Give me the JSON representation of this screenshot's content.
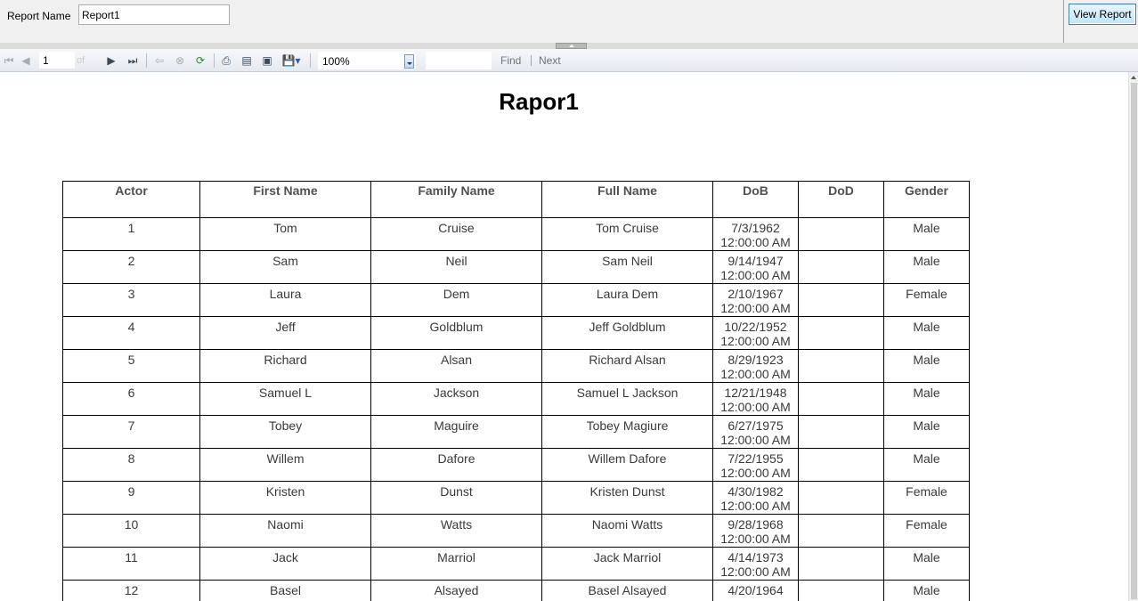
{
  "parameters": {
    "label": "Report Name",
    "value": "Report1"
  },
  "view_report_label": "View Report",
  "toolbar": {
    "page_number": "1",
    "zoom": "100%",
    "find_label": "Find",
    "next_label": "Next",
    "icons": [
      "first-page-icon",
      "previous-page-icon",
      "next-page-icon",
      "last-page-icon",
      "back-icon",
      "stop-icon",
      "refresh-icon",
      "print-icon",
      "print-layout-icon",
      "page-setup-icon",
      "export-icon"
    ]
  },
  "report": {
    "title": "Rapor1",
    "columns": [
      "Actor",
      "First Name",
      "Family Name",
      "Full Name",
      "DoB",
      "DoD",
      "Gender"
    ],
    "rows": [
      [
        "1",
        "Tom",
        "Cruise",
        "Tom Cruise",
        "7/3/1962",
        "12:00:00 AM",
        "",
        "Male"
      ],
      [
        "2",
        "Sam",
        "Neil",
        "Sam Neil",
        "9/14/1947",
        "12:00:00 AM",
        "",
        "Male"
      ],
      [
        "3",
        "Laura",
        "Dem",
        "Laura Dem",
        "2/10/1967",
        "12:00:00 AM",
        "",
        "Female"
      ],
      [
        "4",
        "Jeff",
        "Goldblum",
        "Jeff Goldblum",
        "10/22/1952",
        "12:00:00 AM",
        "",
        "Male"
      ],
      [
        "5",
        "Richard",
        "Alsan",
        "Richard Alsan",
        "8/29/1923",
        "12:00:00 AM",
        "",
        "Male"
      ],
      [
        "6",
        "Samuel L",
        "Jackson",
        "Samuel L Jackson",
        "12/21/1948",
        "12:00:00 AM",
        "",
        "Male"
      ],
      [
        "7",
        "Tobey",
        "Maguire",
        "Tobey Magiure",
        "6/27/1975",
        "12:00:00 AM",
        "",
        "Male"
      ],
      [
        "8",
        "Willem",
        "Dafore",
        "Willem Dafore",
        "7/22/1955",
        "12:00:00 AM",
        "",
        "Male"
      ],
      [
        "9",
        "Kristen",
        "Dunst",
        "Kristen Dunst",
        "4/30/1982",
        "12:00:00 AM",
        "",
        "Female"
      ],
      [
        "10",
        "Naomi",
        "Watts",
        "Naomi Watts",
        "9/28/1968",
        "12:00:00 AM",
        "",
        "Female"
      ],
      [
        "11",
        "Jack",
        "Marriol",
        "Jack Marriol",
        "4/14/1973",
        "12:00:00 AM",
        "",
        "Male"
      ],
      [
        "12",
        "Basel",
        "Alsayed",
        "Basel Alsayed",
        "4/20/1964",
        "",
        "",
        "Male"
      ]
    ]
  }
}
